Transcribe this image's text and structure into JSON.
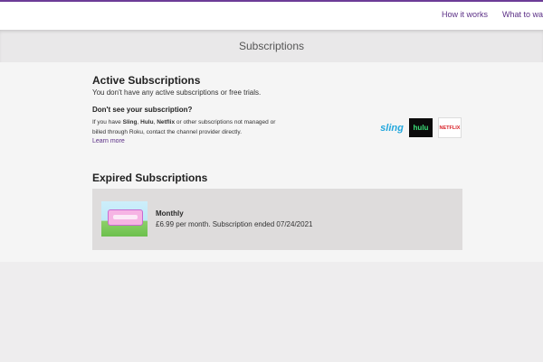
{
  "nav": {
    "items": [
      "How it works",
      "What to wa"
    ]
  },
  "page": {
    "title": "Subscriptions"
  },
  "active": {
    "title": "Active Subscriptions",
    "description": "You don't have any active subscriptions or free trials.",
    "dont_see_title": "Don't see your subscription?",
    "help_prefix": "If you have ",
    "help_brand_1": "Sling",
    "help_sep_1": ", ",
    "help_brand_2": "Hulu",
    "help_sep_2": ", ",
    "help_brand_3": "Netflix",
    "help_suffix": " or other subscriptions not managed or billed through Roku, contact the channel provider directly.",
    "learn_more": "Learn more",
    "logos": {
      "sling": "sling",
      "hulu": "hulu",
      "netflix": "NETFLIX"
    }
  },
  "expired": {
    "title": "Expired Subscriptions",
    "items": [
      {
        "plan": "Monthly",
        "detail": "£6.99 per month. Subscription ended 07/24/2021"
      }
    ]
  },
  "colors": {
    "accent": "#5b2f86",
    "top_border": "#6c3c97",
    "background": "#eeedee",
    "card": "#dedcdc"
  }
}
